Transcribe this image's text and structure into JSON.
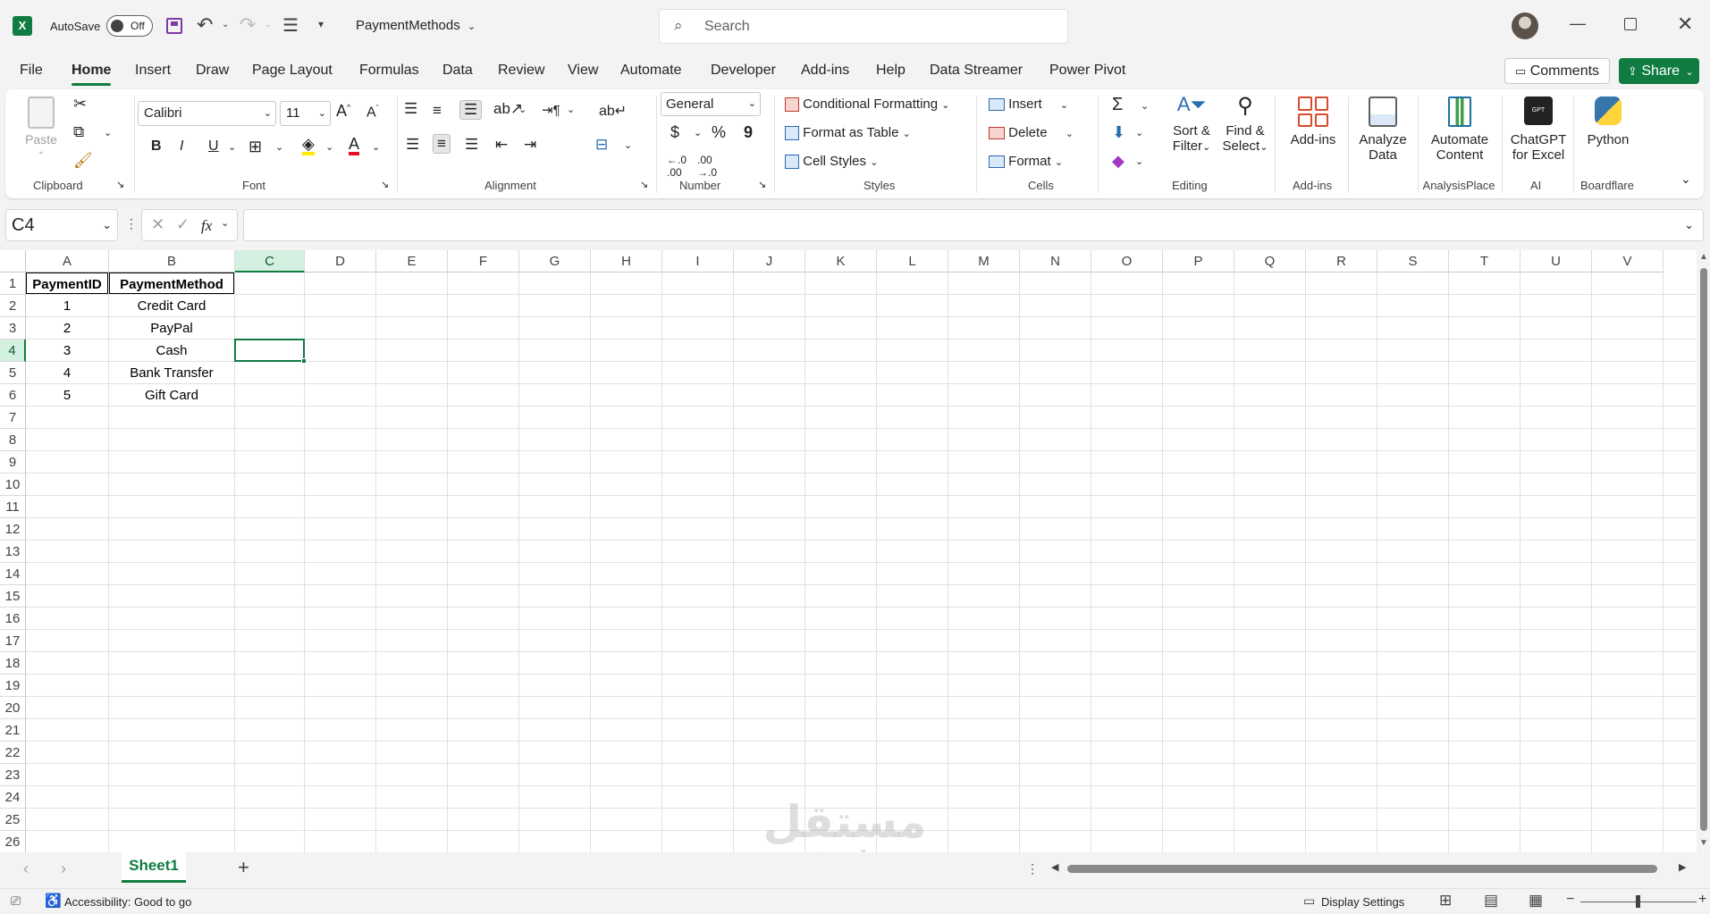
{
  "titlebar": {
    "autosave_label": "AutoSave",
    "autosave_state": "Off",
    "doc_name": "PaymentMethods",
    "search_placeholder": "Search"
  },
  "tabs": [
    "File",
    "Home",
    "Insert",
    "Draw",
    "Page Layout",
    "Formulas",
    "Data",
    "Review",
    "View",
    "Automate",
    "Developer",
    "Add-ins",
    "Help",
    "Data Streamer",
    "Power Pivot"
  ],
  "active_tab": "Home",
  "comments_label": "Comments",
  "share_label": "Share",
  "ribbon": {
    "clipboard": {
      "paste": "Paste",
      "group": "Clipboard"
    },
    "font": {
      "name": "Calibri",
      "size": "11",
      "group": "Font",
      "bold": "B",
      "italic": "I",
      "underline": "U"
    },
    "alignment": {
      "group": "Alignment"
    },
    "number": {
      "format": "General",
      "currency": "$",
      "percent": "%",
      "comma": "9",
      "group": "Number"
    },
    "styles": {
      "conditional": "Conditional Formatting",
      "table": "Format as Table",
      "cell_styles": "Cell Styles",
      "group": "Styles"
    },
    "cells": {
      "insert": "Insert",
      "delete": "Delete",
      "format": "Format",
      "group": "Cells"
    },
    "editing": {
      "sort1": "Sort &",
      "sort2": "Filter",
      "find1": "Find &",
      "find2": "Select",
      "group": "Editing"
    },
    "addins": {
      "label": "Add-ins",
      "group": "Add-ins"
    },
    "analyze": {
      "l1": "Analyze",
      "l2": "Data"
    },
    "automate": {
      "l1": "Automate",
      "l2": "Content",
      "group": "AnalysisPlace"
    },
    "chatgpt": {
      "l1": "ChatGPT",
      "l2": "for Excel",
      "group": "AI"
    },
    "python": {
      "label": "Python",
      "group": "Boardflare"
    }
  },
  "formula_bar": {
    "name_box": "C4",
    "fx": "fx",
    "content": ""
  },
  "columns": [
    "A",
    "B",
    "C",
    "D",
    "E",
    "F",
    "G",
    "H",
    "I",
    "J",
    "K",
    "L",
    "M",
    "N",
    "O",
    "P",
    "Q",
    "R",
    "S",
    "T",
    "U",
    "V"
  ],
  "rows": [
    "1",
    "2",
    "3",
    "4",
    "5",
    "6",
    "7",
    "8",
    "9",
    "10",
    "11",
    "12",
    "13",
    "14",
    "15",
    "16",
    "17",
    "18",
    "19",
    "20",
    "21",
    "22",
    "23",
    "24",
    "25",
    "26"
  ],
  "sheet_cells": {
    "header": [
      "PaymentID",
      "PaymentMethod"
    ],
    "data": [
      [
        "1",
        "Credit Card"
      ],
      [
        "2",
        "PayPal"
      ],
      [
        "3",
        "Cash"
      ],
      [
        "4",
        "Bank Transfer"
      ],
      [
        "5",
        "Gift Card"
      ]
    ]
  },
  "selected_cell": "C4",
  "sheet_tabs": [
    "Sheet1"
  ],
  "watermark": {
    "arabic": "مستقل",
    "latin": "mostaql.com"
  },
  "status": {
    "accessibility": "Accessibility: Good to go",
    "display_settings": "Display Settings"
  },
  "colors": {
    "accent": "#107c41",
    "share_bg": "#107c41"
  }
}
